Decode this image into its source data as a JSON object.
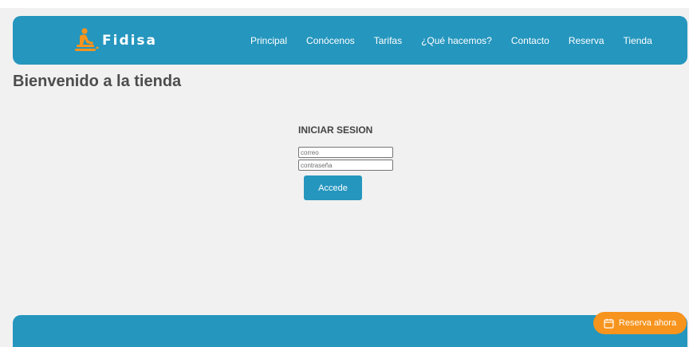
{
  "brand": {
    "name": "Fidisa",
    "logo_icon": "massage-therapist-icon",
    "accent_color": "#f7941d"
  },
  "nav": {
    "items": [
      {
        "label": "Principal"
      },
      {
        "label": "Conócenos"
      },
      {
        "label": "Tarifas"
      },
      {
        "label": "¿Qué hacemos?"
      },
      {
        "label": "Contacto"
      },
      {
        "label": "Reserva"
      },
      {
        "label": "Tienda"
      }
    ]
  },
  "page": {
    "title": "Bienvenido a la tienda"
  },
  "login": {
    "heading": "INICIAR SESION",
    "email_placeholder": "correo",
    "password_placeholder": "contraseña",
    "submit_label": "Accede"
  },
  "floating": {
    "reserve_label": "Reserva ahora",
    "icon": "calendar-icon"
  },
  "colors": {
    "primary": "#2596be",
    "background": "#f1f1f1",
    "cta": "#f7941d"
  }
}
